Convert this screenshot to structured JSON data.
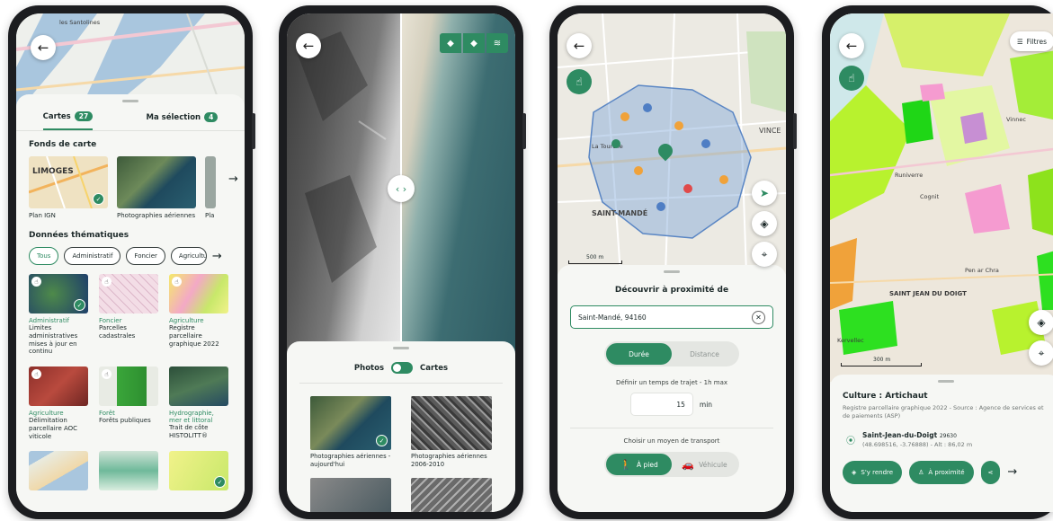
{
  "colors": {
    "accent": "#2e8b62",
    "frame": "#1c1d20",
    "sheet": "#f6f7f4"
  },
  "icons": [
    "arrow-left-icon",
    "check-icon",
    "chevron-right-icon",
    "chevron-left-icon",
    "touch-icon",
    "compass-icon",
    "layers-icon",
    "locate-icon",
    "close-icon",
    "walk-icon",
    "car-icon",
    "pin-icon",
    "directions-icon",
    "person-icon",
    "share-icon",
    "filter-icon"
  ],
  "phone1": {
    "map_labels": [
      "les Santolines"
    ],
    "tabs": [
      {
        "label": "Cartes",
        "count": "27"
      },
      {
        "label": "Ma sélection",
        "count": "4"
      }
    ],
    "basemaps_title": "Fonds de carte",
    "basemaps": [
      {
        "label": "Plan IGN",
        "thumb_text": "LIMOGES"
      },
      {
        "label": "Photographies aériennes"
      },
      {
        "label": "Pla"
      }
    ],
    "thematic_title": "Données thématiques",
    "chips": [
      "Tous",
      "Administratif",
      "Foncier",
      "Agriculture"
    ],
    "cards": [
      {
        "category": "Administratif",
        "title": "Limites administratives mises à jour en continu"
      },
      {
        "category": "Foncier",
        "title": "Parcelles cadastrales"
      },
      {
        "category": "Agriculture",
        "title": "Registre parcellaire graphique 2022"
      },
      {
        "category": "Agriculture",
        "title": "Délimitation parcellaire AOC viticole"
      },
      {
        "category": "Forêt",
        "title": "Forêts publiques"
      },
      {
        "category": "Hydrographie, mer et littoral",
        "title": "Trait de côte HISTOLITT®"
      }
    ]
  },
  "phone2": {
    "toggle_left": "Photos",
    "toggle_right": "Cartes",
    "photos": [
      {
        "label": "Photographies aériennes - aujourd'hui"
      },
      {
        "label": "Photographies aériennes 2006-2010"
      }
    ]
  },
  "phone3": {
    "map_labels": [
      "SAINT-MANDÉ",
      "VINCE",
      "La Tourelle"
    ],
    "scale_label": "500 m",
    "title": "Découvrir à proximité de",
    "search_value": "Saint-Mandé, 94160",
    "segment_options": [
      "Durée",
      "Distance"
    ],
    "time_hint": "Définir un temps de trajet - 1h max",
    "time_value": "15",
    "time_unit": "min",
    "transport_title": "Choisir un moyen de transport",
    "transport_options": [
      "À pied",
      "Véhicule"
    ]
  },
  "phone4": {
    "filters_label": "Filtres",
    "map_labels": [
      "SAINT JEAN DU DOIGT",
      "Runiverre",
      "Pen ar Chra",
      "Cognit",
      "Kervellec",
      "Vinnec"
    ],
    "scale_label": "300 m",
    "title": "Culture : Artichaut",
    "subtitle": "Registre parcellaire graphique 2022 - Source : Agence de services et de paiements (ASP)",
    "place_name": "Saint-Jean-du-Doigt",
    "place_postcode": "29630",
    "place_coords": "(48.698516, -3.76888) - Alt : 86,02 m",
    "actions": [
      "S'y rendre",
      "À proximité"
    ]
  }
}
